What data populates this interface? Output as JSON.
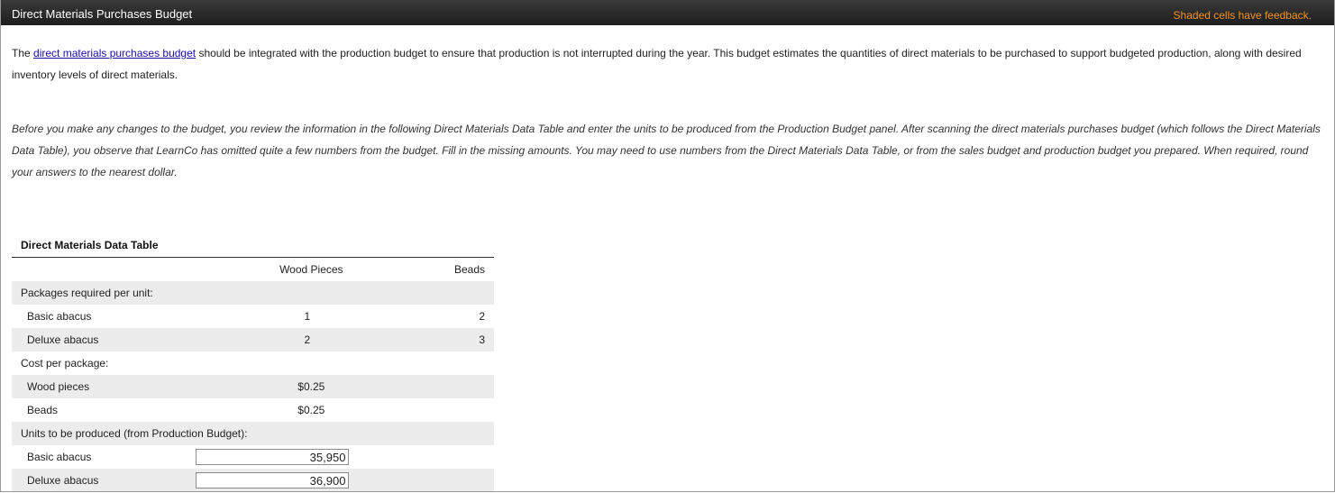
{
  "header": {
    "title": "Direct Materials Purchases Budget",
    "feedback": "Shaded cells have feedback."
  },
  "intro": {
    "prefix": "The ",
    "link": "direct materials purchases budget",
    "suffix": " should be integrated with the production budget to ensure that production is not interrupted during the year. This budget estimates the quantities of direct materials to be purchased to support budgeted production, along with desired inventory levels of direct materials."
  },
  "instructions": "Before you make any changes to the budget, you review the information in the following Direct Materials Data Table and enter the units to be produced from the Production Budget panel. After scanning the direct materials purchases budget (which follows the Direct Materials Data Table), you observe that LearnCo has omitted quite a few numbers from the budget. Fill in the missing amounts. You may need to use numbers from the Direct Materials Data Table, or from the sales budget and production budget you prepared. When required, round your answers to the nearest dollar.",
  "data_table": {
    "title": "Direct Materials Data Table",
    "col_wood": "Wood Pieces",
    "col_beads": "Beads",
    "packages_label": "Packages required per unit:",
    "packages": [
      {
        "label": "Basic abacus",
        "wood": "1",
        "beads": "2"
      },
      {
        "label": "Deluxe abacus",
        "wood": "2",
        "beads": "3"
      }
    ],
    "cost_label": "Cost per package:",
    "costs": [
      {
        "label": "Wood pieces",
        "value": "$0.25"
      },
      {
        "label": "Beads",
        "value": "$0.25"
      }
    ],
    "units_label": "Units to be produced (from Production Budget):",
    "units": [
      {
        "label": "Basic abacus",
        "value": "35,950"
      },
      {
        "label": "Deluxe abacus",
        "value": "36,900"
      }
    ]
  }
}
